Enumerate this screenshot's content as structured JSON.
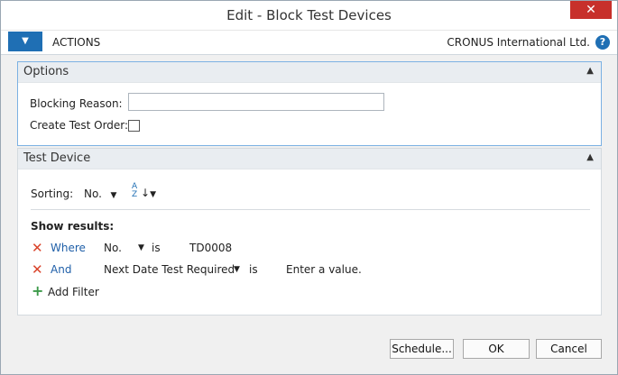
{
  "window": {
    "title": "Edit - Block Test Devices",
    "close_glyph": "✕"
  },
  "ribbon": {
    "menu_glyph": "▼",
    "actions_label": "ACTIONS",
    "company": "CRONUS International Ltd.",
    "help_glyph": "?"
  },
  "options": {
    "title": "Options",
    "collapse_glyph": "▲",
    "blocking_reason_label": "Blocking Reason:",
    "blocking_reason_value": "",
    "create_test_order_label": "Create Test Order:",
    "create_test_order_checked": false
  },
  "test_device": {
    "title": "Test Device",
    "collapse_glyph": "▲",
    "sorting_label": "Sorting:",
    "sorting_value": "No.",
    "sort_order_glyph": "A\nZ",
    "show_results_label": "Show results:",
    "filters": [
      {
        "conjunction": "Where",
        "field": "No.",
        "operator": "is",
        "value": "TD0008"
      },
      {
        "conjunction": "And",
        "field": "Next Date Test Required",
        "operator": "is",
        "value": "Enter a value."
      }
    ],
    "add_filter_label": "Add Filter"
  },
  "footer": {
    "schedule_label": "Schedule...",
    "ok_label": "OK",
    "cancel_label": "Cancel"
  },
  "icons": {
    "remove_filter": "remove-filter-icon",
    "add_filter": "plus-icon",
    "dropdown": "chevron-down-icon",
    "sort": "sort-order-icon"
  },
  "colors": {
    "accent": "#1f6fb4",
    "close": "#c7302b",
    "remove": "#d9432a",
    "add": "#3d9a4a"
  }
}
